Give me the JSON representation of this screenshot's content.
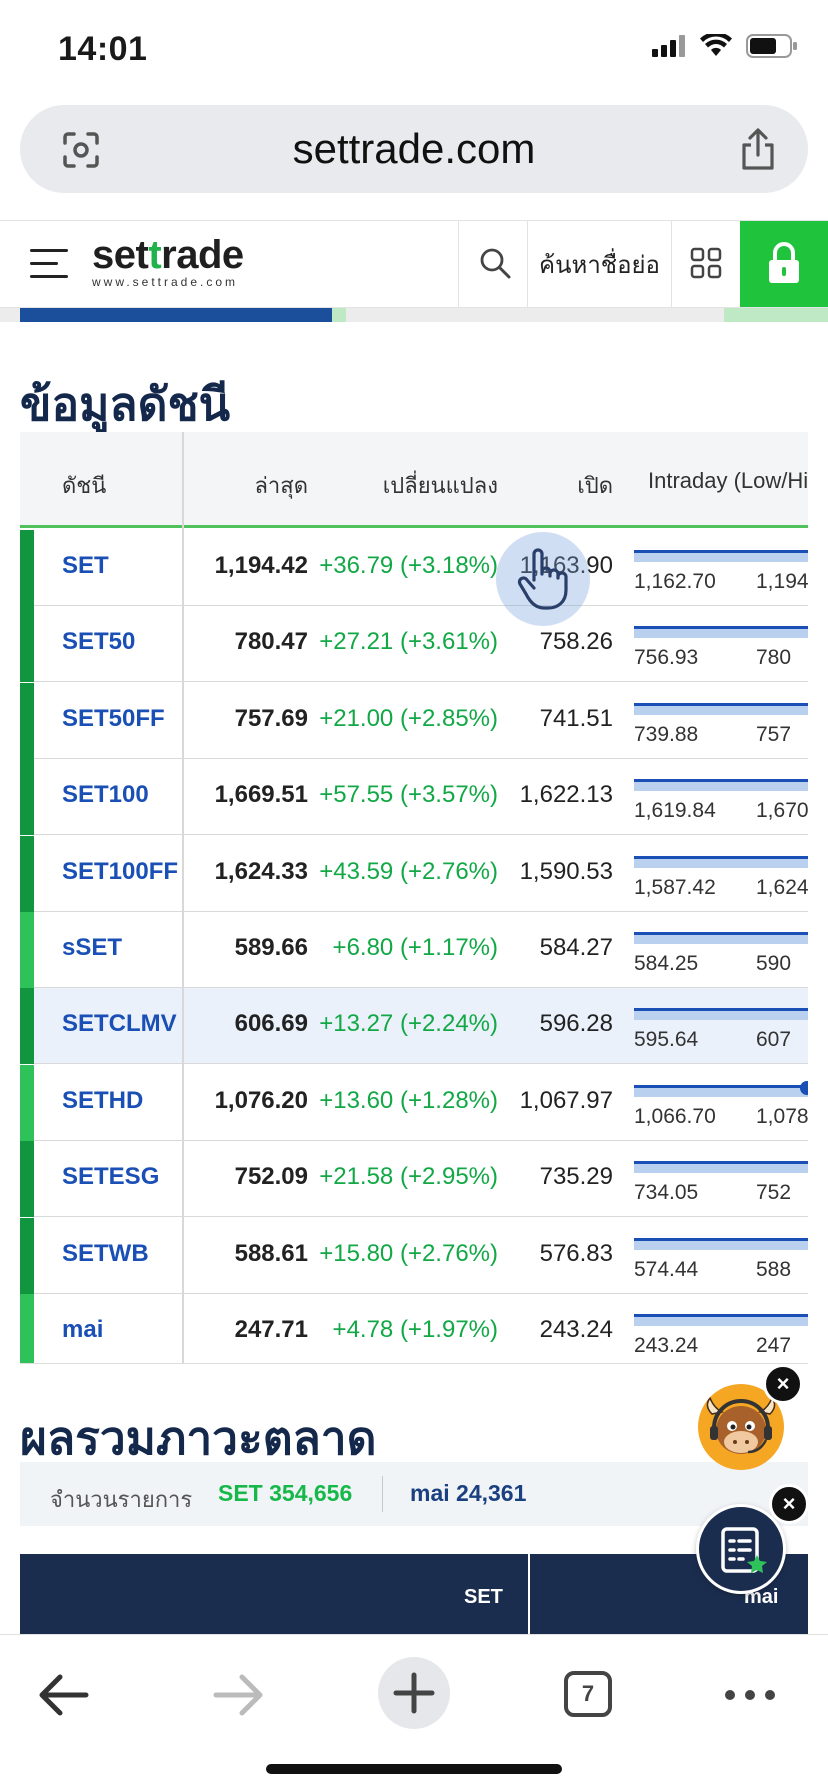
{
  "status": {
    "time": "14:01"
  },
  "browser": {
    "url": "settrade.com",
    "tab_count": "7"
  },
  "header": {
    "logo_prefix": "set",
    "logo_accent": "t",
    "logo_suffix": "rade",
    "logo_sub": "www.settrade.com",
    "symbol_search": "ค้นหาชื่อย่อ",
    "accent_color": "#20c33c"
  },
  "index_section": {
    "title": "ข้อมูลดัชนี",
    "columns": {
      "index": "ดัชนี",
      "last": "ล่าสุด",
      "change": "เปลี่ยนแปลง",
      "open": "เปิด",
      "intraday": "Intraday (Low/Hi"
    },
    "rows": [
      {
        "name": "SET",
        "last": "1,194.42",
        "change": "+36.79 (+3.18%)",
        "open": "1,163.90",
        "low": "1,162.70",
        "high": "1,194",
        "bar": "#11963f"
      },
      {
        "name": "SET50",
        "last": "780.47",
        "change": "+27.21 (+3.61%)",
        "open": "758.26",
        "low": "756.93",
        "high": "780",
        "bar": "#11963f"
      },
      {
        "name": "SET50FF",
        "last": "757.69",
        "change": "+21.00 (+2.85%)",
        "open": "741.51",
        "low": "739.88",
        "high": "757",
        "bar": "#11963f"
      },
      {
        "name": "SET100",
        "last": "1,669.51",
        "change": "+57.55 (+3.57%)",
        "open": "1,622.13",
        "low": "1,619.84",
        "high": "1,670",
        "bar": "#11963f"
      },
      {
        "name": "SET100FF",
        "last": "1,624.33",
        "change": "+43.59 (+2.76%)",
        "open": "1,590.53",
        "low": "1,587.42",
        "high": "1,624",
        "bar": "#11963f"
      },
      {
        "name": "sSET",
        "last": "589.66",
        "change": "+6.80 (+1.17%)",
        "open": "584.27",
        "low": "584.25",
        "high": "590",
        "bar": "#2fc25b"
      },
      {
        "name": "SETCLMV",
        "last": "606.69",
        "change": "+13.27 (+2.24%)",
        "open": "596.28",
        "low": "595.64",
        "high": "607",
        "bar": "#11963f"
      },
      {
        "name": "SETHD",
        "last": "1,076.20",
        "change": "+13.60 (+1.28%)",
        "open": "1,067.97",
        "low": "1,066.70",
        "high": "1,078",
        "bar": "#2fc25b"
      },
      {
        "name": "SETESG",
        "last": "752.09",
        "change": "+21.58 (+2.95%)",
        "open": "735.29",
        "low": "734.05",
        "high": "752",
        "bar": "#11963f"
      },
      {
        "name": "SETWB",
        "last": "588.61",
        "change": "+15.80 (+2.76%)",
        "open": "576.83",
        "low": "574.44",
        "high": "588",
        "bar": "#11963f"
      },
      {
        "name": "mai",
        "last": "247.71",
        "change": "+4.78 (+1.97%)",
        "open": "243.24",
        "low": "243.24",
        "high": "247",
        "bar": "#2fc25b"
      }
    ]
  },
  "market_section": {
    "title": "ผลรวมภาวะตลาด",
    "deals_label": "จำนวนรายการ",
    "deals_set": "SET 354,656",
    "deals_mai": "mai 24,361",
    "col_set": "SET",
    "col_mai": "mai"
  },
  "colors": {
    "up_green": "#11a845",
    "link_blue": "#1a4fb5",
    "navy": "#1b2d4f"
  }
}
